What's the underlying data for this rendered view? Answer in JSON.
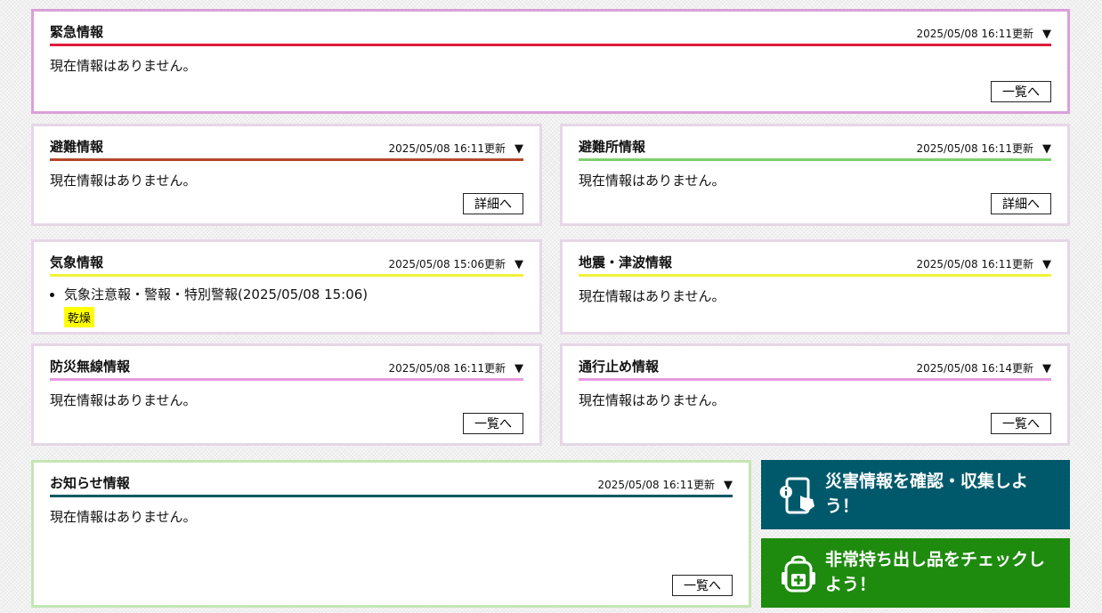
{
  "panels": {
    "emergency": {
      "title": "緊急情報",
      "updated": "2025/05/08 16:11更新",
      "body": "現在情報はありません。",
      "button": "一覧へ",
      "accent": "#e01a3a",
      "border": "#d9a0d9"
    },
    "evacuation": {
      "title": "避難情報",
      "updated": "2025/05/08 16:11更新",
      "body": "現在情報はありません。",
      "button": "詳細へ",
      "accent": "#b5462a"
    },
    "shelter": {
      "title": "避難所情報",
      "updated": "2025/05/08 16:11更新",
      "body": "現在情報はありません。",
      "button": "詳細へ",
      "accent": "#7dcf6d"
    },
    "weather": {
      "title": "気象情報",
      "updated": "2025/05/08 15:06更新",
      "items": [
        {
          "text": "気象注意報・警報・特別警報(2025/05/08 15:06)",
          "tag": "乾燥"
        }
      ],
      "accent": "#f2f23a"
    },
    "quake": {
      "title": "地震・津波情報",
      "updated": "2025/05/08 16:11更新",
      "body": "現在情報はありません。",
      "accent": "#f2f23a"
    },
    "radio": {
      "title": "防災無線情報",
      "updated": "2025/05/08 16:11更新",
      "body": "現在情報はありません。",
      "button": "一覧へ",
      "accent": "#e79be0"
    },
    "traffic": {
      "title": "通行止め情報",
      "updated": "2025/05/08 16:14更新",
      "body": "現在情報はありません。",
      "button": "一覧へ",
      "accent": "#e79be0"
    },
    "notice": {
      "title": "お知らせ情報",
      "updated": "2025/05/08 16:11更新",
      "body": "現在情報はありません。",
      "button": "一覧へ",
      "accent": "#0e5a63",
      "border": "#c4e6b4"
    }
  },
  "toggle_glyph": "▼",
  "cta": {
    "collect": {
      "label": "災害情報を確認・収集しよう！",
      "icon": "smartphone-info-icon",
      "color": "#00596b"
    },
    "checklist": {
      "label": "非常持ち出し品をチェックしよう！",
      "icon": "emergency-backpack-icon",
      "color": "#1e8b0e"
    }
  }
}
